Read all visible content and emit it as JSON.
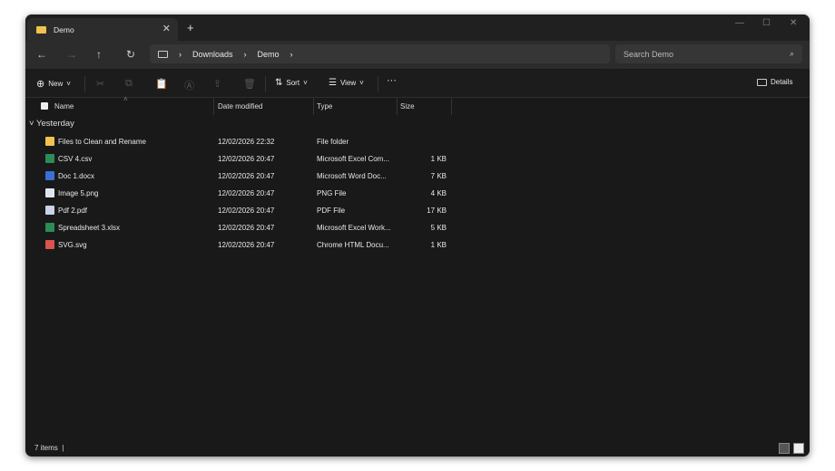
{
  "tab": {
    "title": "Demo",
    "close": "✕",
    "new_tab": "+"
  },
  "window_controls": {
    "minimize": "—",
    "maximize": "☐",
    "close": "✕"
  },
  "nav": {
    "back": "←",
    "forward": "→",
    "up": "↑",
    "refresh": "↻"
  },
  "breadcrumb": [
    "Downloads",
    "Demo"
  ],
  "search": {
    "placeholder": "Search Demo"
  },
  "toolbar": {
    "new": "New",
    "sort": "Sort",
    "view": "View",
    "more": "···",
    "details": "Details"
  },
  "columns": [
    "Name",
    "Date modified",
    "Type",
    "Size"
  ],
  "group": "Yesterday",
  "files": [
    {
      "name": "Files to Clean and Rename",
      "date": "12/02/2026 22:32",
      "type": "File folder",
      "size": "",
      "icon": "folder-icon",
      "color": "#f2c14e"
    },
    {
      "name": "CSV 4.csv",
      "date": "12/02/2026 20:47",
      "type": "Microsoft Excel Com...",
      "size": "1 KB",
      "icon": "excel-csv-icon",
      "color": "#2e8b57"
    },
    {
      "name": "Doc 1.docx",
      "date": "12/02/2026 20:47",
      "type": "Microsoft Word Doc...",
      "size": "7 KB",
      "icon": "word-icon",
      "color": "#3b6fd6"
    },
    {
      "name": "Image 5.png",
      "date": "12/02/2026 20:47",
      "type": "PNG File",
      "size": "4 KB",
      "icon": "image-icon",
      "color": "#dfe6f0"
    },
    {
      "name": "Pdf 2.pdf",
      "date": "12/02/2026 20:47",
      "type": "PDF File",
      "size": "17 KB",
      "icon": "pdf-icon",
      "color": "#c9d2e6"
    },
    {
      "name": "Spreadsheet 3.xlsx",
      "date": "12/02/2026 20:47",
      "type": "Microsoft Excel Work...",
      "size": "5 KB",
      "icon": "excel-icon",
      "color": "#2e8b57"
    },
    {
      "name": "SVG.svg",
      "date": "12/02/2026 20:47",
      "type": "Chrome HTML Docu...",
      "size": "1 KB",
      "icon": "chrome-icon",
      "color": "#d9534f"
    }
  ],
  "status": {
    "count": "7 items"
  }
}
